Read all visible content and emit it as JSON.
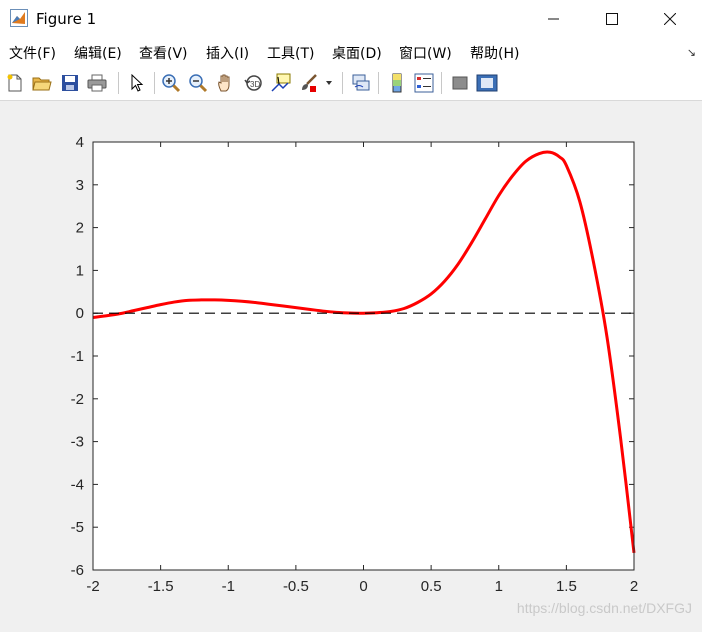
{
  "window": {
    "title": "Figure 1",
    "minimize": "—",
    "maximize": "☐",
    "close": "✕"
  },
  "menu": {
    "items": [
      {
        "label": "文件(F)"
      },
      {
        "label": "编辑(E)"
      },
      {
        "label": "查看(V)"
      },
      {
        "label": "插入(I)"
      },
      {
        "label": "工具(T)"
      },
      {
        "label": "桌面(D)"
      },
      {
        "label": "窗口(W)"
      },
      {
        "label": "帮助(H)"
      }
    ],
    "corner_icon": "↘"
  },
  "toolbar": {
    "icons": [
      "new-figure-icon",
      "open-file-icon",
      "save-icon",
      "print-icon",
      "select-arrow-icon",
      "zoom-in-icon",
      "zoom-out-icon",
      "pan-hand-icon",
      "rotate-3d-icon",
      "data-cursor-icon",
      "brush-icon",
      "link-plot-icon",
      "colorbar-icon",
      "legend-icon",
      "hide-plot-tools-icon",
      "show-plot-tools-icon"
    ]
  },
  "watermark": "https://blog.csdn.net/DXFGJ",
  "chart_data": {
    "type": "line",
    "title": "",
    "xlabel": "",
    "ylabel": "",
    "xlim": [
      -2,
      2
    ],
    "ylim": [
      -6,
      4
    ],
    "xticks": [
      "-2",
      "-1.5",
      "-1",
      "-0.5",
      "0",
      "0.5",
      "1",
      "1.5",
      "2"
    ],
    "yticks": [
      "4",
      "3",
      "2",
      "1",
      "0",
      "-1",
      "-2",
      "-3",
      "-4",
      "-5",
      "-6"
    ],
    "grid": false,
    "colors": {
      "curve": "#ff0000",
      "reference_line": "#000000"
    },
    "series": [
      {
        "style": "solid",
        "x": [
          -2.0,
          -1.9,
          -1.8,
          -1.7,
          -1.6,
          -1.5,
          -1.4,
          -1.3,
          -1.2,
          -1.1,
          -1.0,
          -0.9,
          -0.8,
          -0.7,
          -0.6,
          -0.5,
          -0.4,
          -0.3,
          -0.2,
          -0.1,
          0.0,
          0.1,
          0.2,
          0.3,
          0.4,
          0.5,
          0.6,
          0.7,
          0.8,
          0.9,
          1.0,
          1.1,
          1.2,
          1.3,
          1.38,
          1.45,
          1.5,
          1.6,
          1.7,
          1.8,
          1.9,
          2.0
        ],
        "y": [
          -0.1,
          -0.06,
          -0.01,
          0.06,
          0.13,
          0.2,
          0.26,
          0.3,
          0.31,
          0.31,
          0.3,
          0.28,
          0.25,
          0.21,
          0.17,
          0.13,
          0.09,
          0.05,
          0.02,
          0.005,
          0.0,
          0.01,
          0.04,
          0.11,
          0.25,
          0.45,
          0.75,
          1.15,
          1.65,
          2.2,
          2.75,
          3.2,
          3.55,
          3.73,
          3.76,
          3.65,
          3.45,
          2.6,
          1.2,
          -0.55,
          -2.9,
          -5.6
        ]
      },
      {
        "style": "dashed",
        "x": [
          -2,
          2
        ],
        "y": [
          0,
          0
        ]
      }
    ]
  }
}
